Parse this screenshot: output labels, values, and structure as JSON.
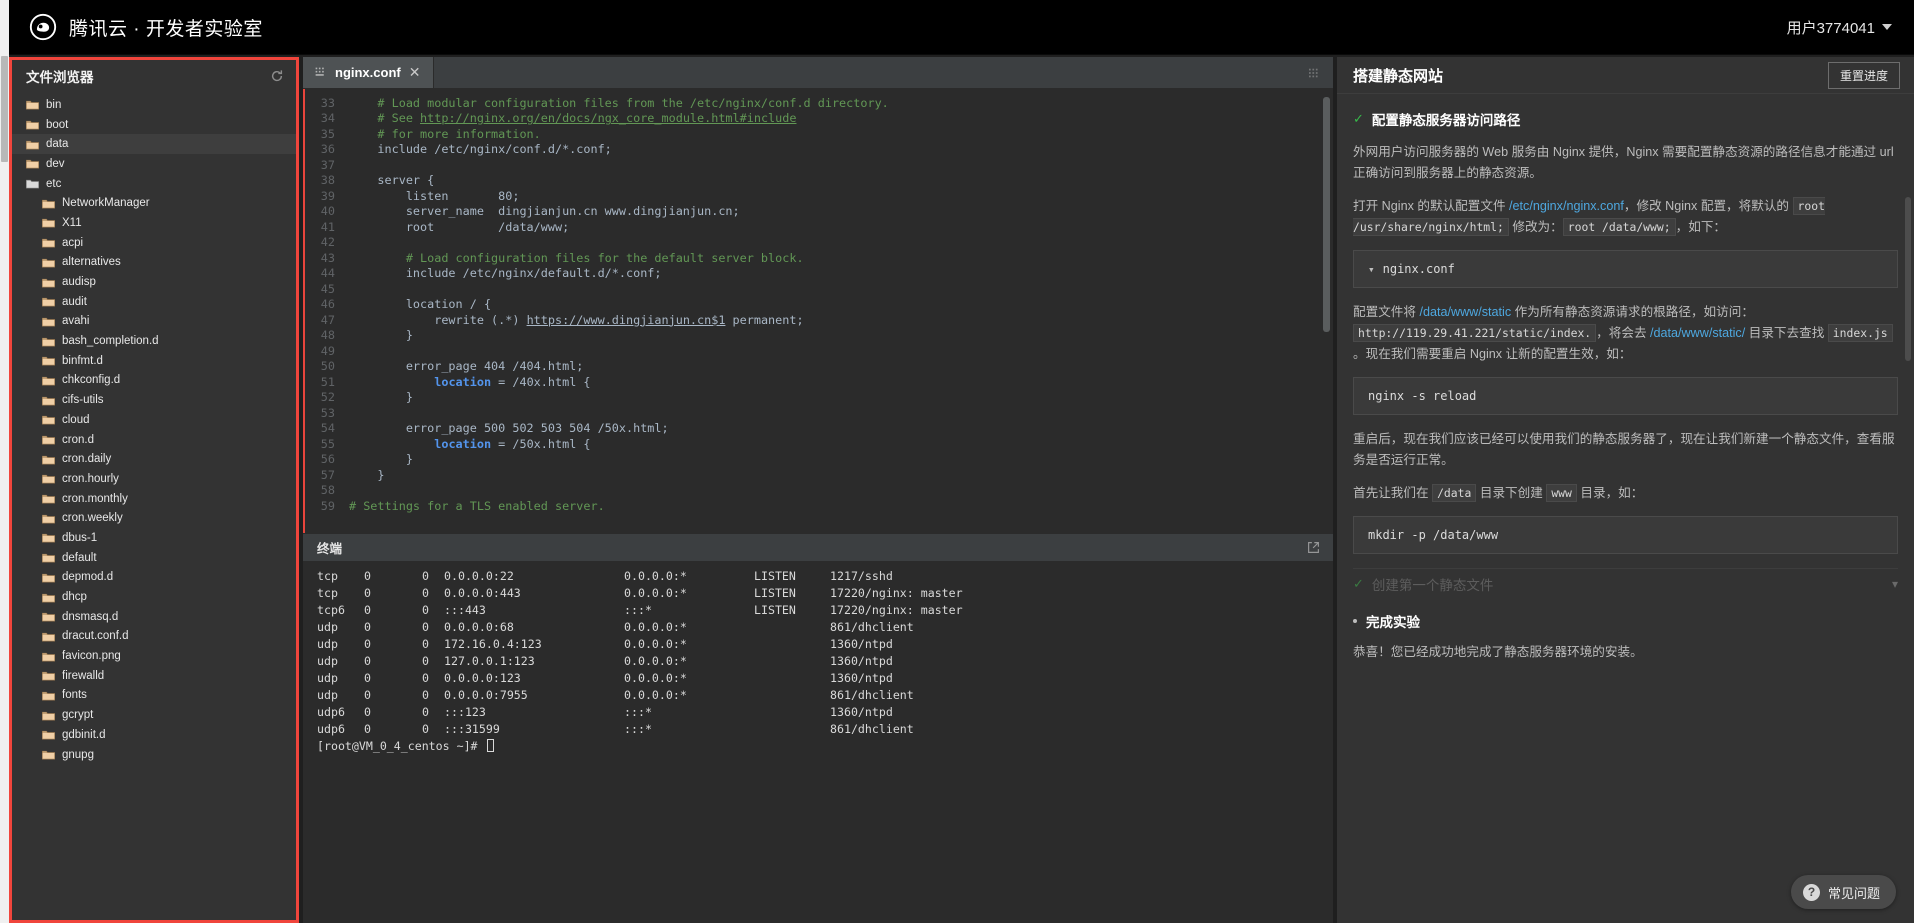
{
  "header": {
    "brand": "腾讯云 · 开发者实验室",
    "logo_icon": "cloud-logo-icon",
    "user_label": "用户3774041",
    "caret_icon": "chevron-down-icon"
  },
  "sidebar": {
    "title": "文件浏览器",
    "refresh_icon": "refresh-icon",
    "items": [
      {
        "name": "bin",
        "indent": 0,
        "selected": false,
        "open": false
      },
      {
        "name": "boot",
        "indent": 0,
        "selected": false,
        "open": false
      },
      {
        "name": "data",
        "indent": 0,
        "selected": true,
        "open": false
      },
      {
        "name": "dev",
        "indent": 0,
        "selected": false,
        "open": false
      },
      {
        "name": "etc",
        "indent": 0,
        "selected": false,
        "open": true
      },
      {
        "name": "NetworkManager",
        "indent": 1,
        "selected": false,
        "open": false
      },
      {
        "name": "X11",
        "indent": 1,
        "selected": false,
        "open": false
      },
      {
        "name": "acpi",
        "indent": 1,
        "selected": false,
        "open": false
      },
      {
        "name": "alternatives",
        "indent": 1,
        "selected": false,
        "open": false
      },
      {
        "name": "audisp",
        "indent": 1,
        "selected": false,
        "open": false
      },
      {
        "name": "audit",
        "indent": 1,
        "selected": false,
        "open": false
      },
      {
        "name": "avahi",
        "indent": 1,
        "selected": false,
        "open": false
      },
      {
        "name": "bash_completion.d",
        "indent": 1,
        "selected": false,
        "open": false
      },
      {
        "name": "binfmt.d",
        "indent": 1,
        "selected": false,
        "open": false
      },
      {
        "name": "chkconfig.d",
        "indent": 1,
        "selected": false,
        "open": false
      },
      {
        "name": "cifs-utils",
        "indent": 1,
        "selected": false,
        "open": false
      },
      {
        "name": "cloud",
        "indent": 1,
        "selected": false,
        "open": false
      },
      {
        "name": "cron.d",
        "indent": 1,
        "selected": false,
        "open": false
      },
      {
        "name": "cron.daily",
        "indent": 1,
        "selected": false,
        "open": false
      },
      {
        "name": "cron.hourly",
        "indent": 1,
        "selected": false,
        "open": false
      },
      {
        "name": "cron.monthly",
        "indent": 1,
        "selected": false,
        "open": false
      },
      {
        "name": "cron.weekly",
        "indent": 1,
        "selected": false,
        "open": false
      },
      {
        "name": "dbus-1",
        "indent": 1,
        "selected": false,
        "open": false
      },
      {
        "name": "default",
        "indent": 1,
        "selected": false,
        "open": false
      },
      {
        "name": "depmod.d",
        "indent": 1,
        "selected": false,
        "open": false
      },
      {
        "name": "dhcp",
        "indent": 1,
        "selected": false,
        "open": false
      },
      {
        "name": "dnsmasq.d",
        "indent": 1,
        "selected": false,
        "open": false
      },
      {
        "name": "dracut.conf.d",
        "indent": 1,
        "selected": false,
        "open": false
      },
      {
        "name": "favicon.png",
        "indent": 1,
        "selected": false,
        "open": false
      },
      {
        "name": "firewalld",
        "indent": 1,
        "selected": false,
        "open": false
      },
      {
        "name": "fonts",
        "indent": 1,
        "selected": false,
        "open": false
      },
      {
        "name": "gcrypt",
        "indent": 1,
        "selected": false,
        "open": false
      },
      {
        "name": "gdbinit.d",
        "indent": 1,
        "selected": false,
        "open": false
      },
      {
        "name": "gnupg",
        "indent": 1,
        "selected": false,
        "open": false
      }
    ]
  },
  "editor": {
    "tab_label": "nginx.conf",
    "tab_icon": "settings-sliders-icon",
    "tab_close_icon": "close-icon",
    "grip_icon": "grip-dots-icon",
    "lines": [
      {
        "no": "33",
        "indent": 4,
        "type": "comment",
        "text": "# Load modular configuration files from the /etc/nginx/conf.d directory."
      },
      {
        "no": "34",
        "indent": 4,
        "type": "comment-link",
        "pre": "# See ",
        "link": "http://nginx.org/en/docs/ngx_core_module.html#include"
      },
      {
        "no": "35",
        "indent": 4,
        "type": "comment",
        "text": "# for more information."
      },
      {
        "no": "36",
        "indent": 4,
        "type": "plain",
        "text": "include /etc/nginx/conf.d/*.conf;"
      },
      {
        "no": "37",
        "indent": 0,
        "type": "plain",
        "text": ""
      },
      {
        "no": "38",
        "indent": 4,
        "type": "plain",
        "text": "server {"
      },
      {
        "no": "39",
        "indent": 8,
        "type": "plain",
        "text": "listen       80;"
      },
      {
        "no": "40",
        "indent": 8,
        "type": "plain",
        "text": "server_name  dingjianjun.cn www.dingjianjun.cn;"
      },
      {
        "no": "41",
        "indent": 8,
        "type": "plain",
        "text": "root         /data/www;"
      },
      {
        "no": "42",
        "indent": 0,
        "type": "plain",
        "text": ""
      },
      {
        "no": "43",
        "indent": 8,
        "type": "comment",
        "text": "# Load configuration files for the default server block."
      },
      {
        "no": "44",
        "indent": 8,
        "type": "plain",
        "text": "include /etc/nginx/default.d/*.conf;"
      },
      {
        "no": "45",
        "indent": 0,
        "type": "plain",
        "text": ""
      },
      {
        "no": "46",
        "indent": 8,
        "type": "plain",
        "text": "location / {"
      },
      {
        "no": "47",
        "indent": 12,
        "type": "rewrite",
        "pre": "rewrite (.*) ",
        "link": "https://www.dingjianjun.cn$1",
        "post": " permanent;"
      },
      {
        "no": "48",
        "indent": 8,
        "type": "plain",
        "text": "}"
      },
      {
        "no": "49",
        "indent": 0,
        "type": "plain",
        "text": ""
      },
      {
        "no": "50",
        "indent": 8,
        "type": "plain",
        "text": "error_page 404 /404.html;"
      },
      {
        "no": "51",
        "indent": 12,
        "type": "loc",
        "kw": "location",
        "text": " = /40x.html {"
      },
      {
        "no": "52",
        "indent": 8,
        "type": "plain",
        "text": "}"
      },
      {
        "no": "53",
        "indent": 0,
        "type": "plain",
        "text": ""
      },
      {
        "no": "54",
        "indent": 8,
        "type": "plain",
        "text": "error_page 500 502 503 504 /50x.html;"
      },
      {
        "no": "55",
        "indent": 12,
        "type": "loc",
        "kw": "location",
        "text": " = /50x.html {"
      },
      {
        "no": "56",
        "indent": 8,
        "type": "plain",
        "text": "}"
      },
      {
        "no": "57",
        "indent": 4,
        "type": "plain",
        "text": "}"
      },
      {
        "no": "58",
        "indent": 0,
        "type": "plain",
        "text": ""
      },
      {
        "no": "59",
        "indent": 0,
        "type": "comment",
        "text": "# Settings for a TLS enabled server."
      }
    ]
  },
  "terminal": {
    "title": "终端",
    "popout_icon": "external-link-icon",
    "rows": [
      {
        "proto": "tcp",
        "recvq": "0",
        "sendq": "0",
        "local": "0.0.0.0:22",
        "foreign": "0.0.0.0:*",
        "state": "LISTEN",
        "pid": "1217/sshd"
      },
      {
        "proto": "tcp",
        "recvq": "0",
        "sendq": "0",
        "local": "0.0.0.0:443",
        "foreign": "0.0.0.0:*",
        "state": "LISTEN",
        "pid": "17220/nginx: master"
      },
      {
        "proto": "tcp6",
        "recvq": "0",
        "sendq": "0",
        "local": ":::443",
        "foreign": ":::*",
        "state": "LISTEN",
        "pid": "17220/nginx: master"
      },
      {
        "proto": "udp",
        "recvq": "0",
        "sendq": "0",
        "local": "0.0.0.0:68",
        "foreign": "0.0.0.0:*",
        "state": "",
        "pid": "861/dhclient"
      },
      {
        "proto": "udp",
        "recvq": "0",
        "sendq": "0",
        "local": "172.16.0.4:123",
        "foreign": "0.0.0.0:*",
        "state": "",
        "pid": "1360/ntpd"
      },
      {
        "proto": "udp",
        "recvq": "0",
        "sendq": "0",
        "local": "127.0.0.1:123",
        "foreign": "0.0.0.0:*",
        "state": "",
        "pid": "1360/ntpd"
      },
      {
        "proto": "udp",
        "recvq": "0",
        "sendq": "0",
        "local": "0.0.0.0:123",
        "foreign": "0.0.0.0:*",
        "state": "",
        "pid": "1360/ntpd"
      },
      {
        "proto": "udp",
        "recvq": "0",
        "sendq": "0",
        "local": "0.0.0.0:7955",
        "foreign": "0.0.0.0:*",
        "state": "",
        "pid": "861/dhclient"
      },
      {
        "proto": "udp6",
        "recvq": "0",
        "sendq": "0",
        "local": ":::123",
        "foreign": ":::*",
        "state": "",
        "pid": "1360/ntpd"
      },
      {
        "proto": "udp6",
        "recvq": "0",
        "sendq": "0",
        "local": ":::31599",
        "foreign": ":::*",
        "state": "",
        "pid": "861/dhclient"
      }
    ],
    "prompt": "[root@VM_0_4_centos ~]# "
  },
  "rightpanel": {
    "title": "搭建静态网站",
    "reset_label": "重置进度",
    "step1_title": "配置静态服务器访问路径",
    "p1": "外网用户访问服务器的 Web 服务由 Nginx 提供，Nginx 需要配置静态资源的路径信息才能通过 url 正确访问到服务器上的静态资源。",
    "p2_a": "打开 Nginx 的默认配置文件 ",
    "p2_link": "/etc/nginx/nginx.conf",
    "p2_b": "，修改 Nginx 配置，将默认的 ",
    "p2_code1": "root /usr/share/nginx/html;",
    "p2_c": " 修改为：",
    "p2_code2": "root /data/www;",
    "p2_d": "，如下：",
    "code1": "nginx.conf",
    "p3_a": "配置文件将 ",
    "p3_link1": "/data/www/static",
    "p3_b": " 作为所有静态资源请求的根路径，如访问：",
    "p3_code": "http://119.29.41.221/static/index.",
    "p3_c": "，将会去 ",
    "p3_link2": "/data/www/static/",
    "p3_d": " 目录下去查找 ",
    "p3_code2": "index.js",
    "p3_e": " 。现在我们需要重启 Nginx 让新的配置生效，如：",
    "code2": "nginx -s reload",
    "p4": "重启后，现在我们应该已经可以使用我们的静态服务器了，现在让我们新建一个静态文件，查看服务是否运行正常。",
    "p5_a": "首先让我们在 ",
    "p5_code1": "/data",
    "p5_b": " 目录下创建 ",
    "p5_code2": "www",
    "p5_c": " 目录，如：",
    "code3": "mkdir -p /data/www",
    "step2_title": "创建第一个静态文件",
    "step3_title": "完成实验",
    "p6": "恭喜！您已经成功地完成了静态服务器环境的安装。",
    "check_icon": "check-icon",
    "chevron_icon": "chevron-down-icon"
  },
  "fab": {
    "label": "常见问题",
    "icon": "question-mark-icon"
  },
  "colors": {
    "accent_red": "#f0453c",
    "brand_black": "#000000",
    "panel_bg": "#333333",
    "editor_bg": "#2b2b2b",
    "link_blue": "#4ea8e0",
    "check_green": "#37b84a"
  }
}
